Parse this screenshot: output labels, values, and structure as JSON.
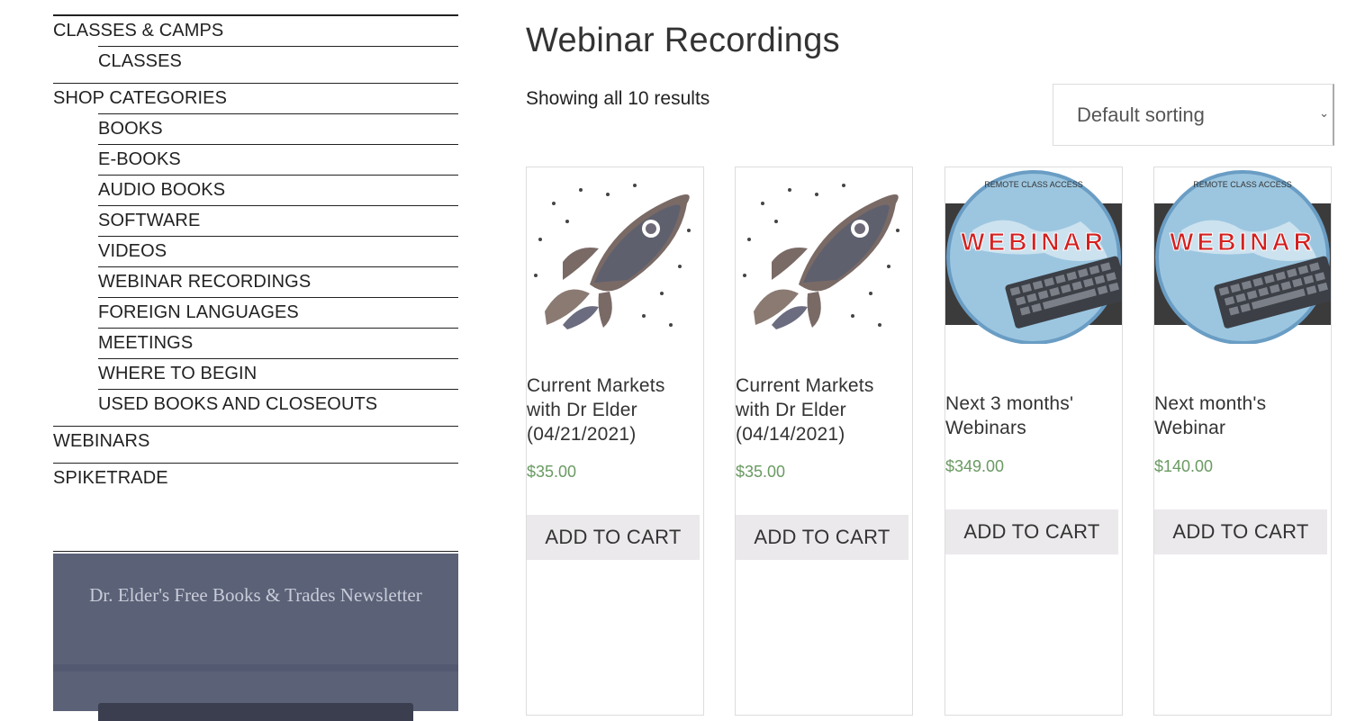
{
  "sidebar": {
    "categories": [
      {
        "label": "CLASSES & CAMPS",
        "children": [
          "CLASSES"
        ]
      },
      {
        "label": "SHOP CATEGORIES",
        "children": [
          "BOOKS",
          "E-BOOKS",
          "AUDIO BOOKS",
          "SOFTWARE",
          "VIDEOS",
          "WEBINAR RECORDINGS",
          "FOREIGN LANGUAGES",
          "MEETINGS",
          "WHERE TO BEGIN",
          "USED BOOKS AND CLOSEOUTS"
        ]
      },
      {
        "label": "WEBINARS",
        "children": []
      },
      {
        "label": "SPIKETRADE",
        "children": []
      }
    ],
    "newsletter_title": "Dr. Elder's Free Books & Trades Newsletter"
  },
  "main": {
    "title": "Webinar Recordings",
    "result_count": "Showing all 10 results",
    "sort": {
      "selected": "Default sorting"
    },
    "products": [
      {
        "title": "Current Markets with Dr Elder (04/21/2021)",
        "price": "$35.00",
        "button": "ADD TO CART",
        "image": "rocket-crowd"
      },
      {
        "title": "Current Markets with Dr Elder (04/14/2021)",
        "price": "$35.00",
        "button": "ADD TO CART",
        "image": "rocket-crowd"
      },
      {
        "title": "Next 3 months' Webinars",
        "price": "$349.00",
        "button": "ADD TO CART",
        "image": "webinar-globe",
        "image_text": "WEBINAR",
        "image_caption": "REMOTE CLASS ACCESS"
      },
      {
        "title": "Next month's Webinar",
        "price": "$140.00",
        "button": "ADD TO CART",
        "image": "webinar-globe",
        "image_text": "WEBINAR",
        "image_caption": "REMOTE CLASS ACCESS"
      }
    ]
  },
  "colors": {
    "price": "#6a9a62",
    "newsletter_bg": "#5b6177",
    "button_bg": "#ebe9eb"
  }
}
